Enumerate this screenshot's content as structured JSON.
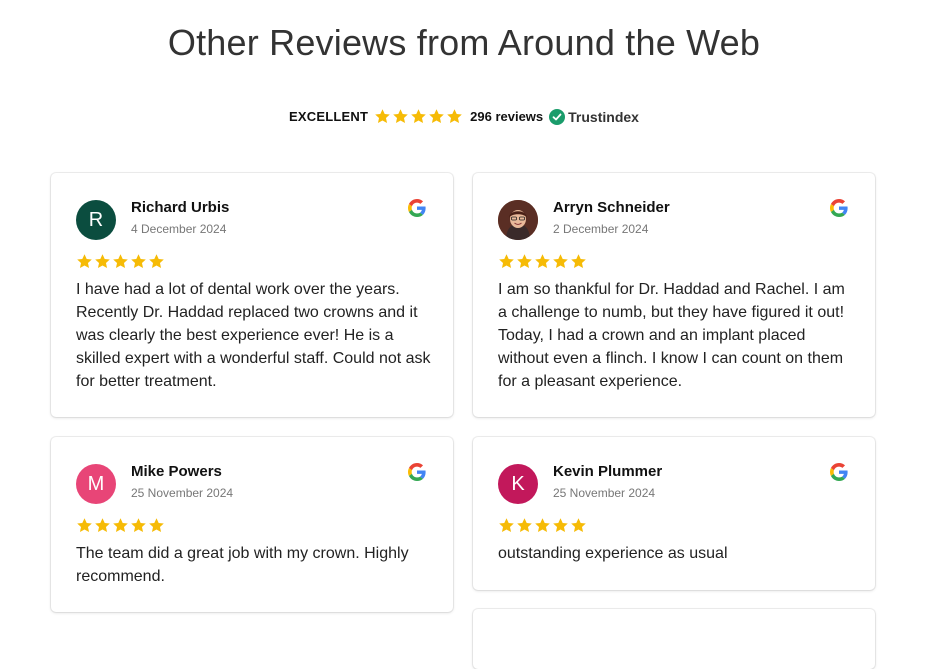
{
  "page": {
    "title": "Other Reviews from Around the Web"
  },
  "summary": {
    "rating_label": "EXCELLENT",
    "stars": 5,
    "reviews_count": "296 reviews",
    "provider": "Trustindex"
  },
  "colors": {
    "star": "#f6bb06",
    "trust_green": "#1a9c6b"
  },
  "reviews": [
    {
      "name": "Richard Urbis",
      "date": "4 December 2024",
      "initial": "R",
      "avatar_color": "#0b4d3f",
      "rating": 5,
      "source_icon": "google-icon",
      "text": "I have had a lot of dental work over the years. Recently Dr. Haddad replaced two crowns and it was clearly the best experience ever! He is a skilled expert with a wonderful staff. Could not ask for better treatment."
    },
    {
      "name": "Arryn Schneider",
      "date": "2 December 2024",
      "initial": "",
      "avatar_color": "#7a3a2a",
      "rating": 5,
      "source_icon": "google-icon",
      "text": "I am so thankful for Dr. Haddad and Rachel. I am a challenge to numb, but they have figured it out! Today, I had a crown and an implant placed without even a flinch. I know I can count on them for a pleasant experience."
    },
    {
      "name": "Mike Powers",
      "date": "25 November 2024",
      "initial": "M",
      "avatar_color": "#e84577",
      "rating": 5,
      "source_icon": "google-icon",
      "text": "The team did a great job with my crown. Highly recommend."
    },
    {
      "name": "Kevin Plummer",
      "date": "25 November 2024",
      "initial": "K",
      "avatar_color": "#c2185b",
      "rating": 5,
      "source_icon": "google-icon",
      "text": "outstanding experience as usual"
    }
  ]
}
